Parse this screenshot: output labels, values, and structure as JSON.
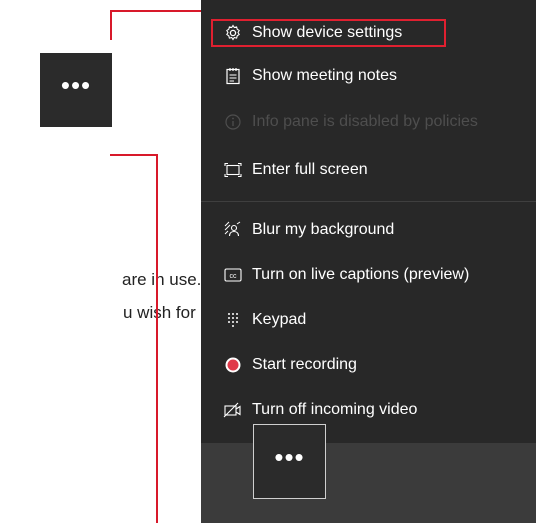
{
  "more_button": {
    "glyph": "•••"
  },
  "menu": {
    "items": [
      {
        "label": "Show device settings",
        "icon": "gear-icon"
      },
      {
        "label": "Show meeting notes",
        "icon": "notes-icon"
      },
      {
        "label": "Info pane is disabled by policies",
        "icon": "info-icon",
        "disabled": true
      },
      {
        "label": "Enter full screen",
        "icon": "fullscreen-icon"
      },
      {
        "label": "Blur my background",
        "icon": "blur-background-icon"
      },
      {
        "label": "Turn on live captions (preview)",
        "icon": "captions-icon"
      },
      {
        "label": "Keypad",
        "icon": "keypad-icon"
      },
      {
        "label": "Start recording",
        "icon": "record-icon"
      },
      {
        "label": "Turn off incoming video",
        "icon": "video-off-icon"
      }
    ]
  },
  "background_text": {
    "line1": "are in use.",
    "line2": "u wish for"
  },
  "colors": {
    "menu_bg": "#282828",
    "callout": "#d8192a",
    "record": "#e03a4a",
    "disabled_text": "#4e4e4e"
  }
}
